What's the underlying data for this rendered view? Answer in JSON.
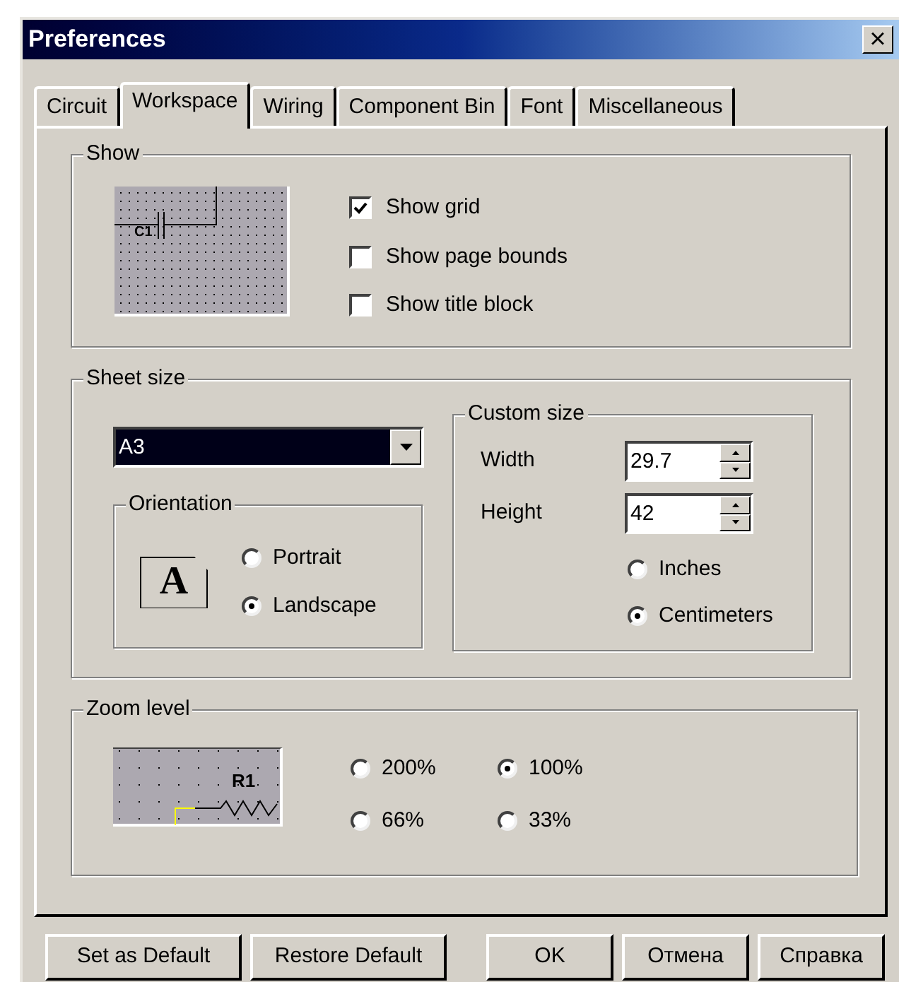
{
  "window": {
    "title": "Preferences",
    "close": "×"
  },
  "tabs": [
    {
      "label": "Circuit",
      "selected": false
    },
    {
      "label": "Workspace",
      "selected": true
    },
    {
      "label": "Wiring",
      "selected": false
    },
    {
      "label": "Component Bin",
      "selected": false
    },
    {
      "label": "Font",
      "selected": false
    },
    {
      "label": "Miscellaneous",
      "selected": false
    }
  ],
  "show": {
    "title": "Show",
    "preview_label": "C1",
    "checkboxes": [
      {
        "label": "Show grid",
        "checked": true
      },
      {
        "label": "Show page bounds",
        "checked": false
      },
      {
        "label": "Show title block",
        "checked": false
      }
    ]
  },
  "sheet_size": {
    "title": "Sheet size",
    "dropdown": {
      "value": "A3"
    },
    "orientation": {
      "title": "Orientation",
      "icon_letter": "A",
      "options": [
        {
          "label": "Portrait",
          "selected": false
        },
        {
          "label": "Landscape",
          "selected": true
        }
      ]
    },
    "custom_size": {
      "title": "Custom size",
      "fields": [
        {
          "label": "Width",
          "value": "29.7"
        },
        {
          "label": "Height",
          "value": "42"
        }
      ],
      "units": [
        {
          "label": "Inches",
          "selected": false
        },
        {
          "label": "Centimeters",
          "selected": true
        }
      ]
    }
  },
  "zoom_level": {
    "title": "Zoom level",
    "preview_label": "R1",
    "options": [
      {
        "label": "200%",
        "selected": false
      },
      {
        "label": "100%",
        "selected": true
      },
      {
        "label": "66%",
        "selected": false
      },
      {
        "label": "33%",
        "selected": false
      }
    ]
  },
  "buttons": [
    "Set as Default",
    "Restore Default",
    "OK",
    "Отмена",
    "Справка"
  ]
}
